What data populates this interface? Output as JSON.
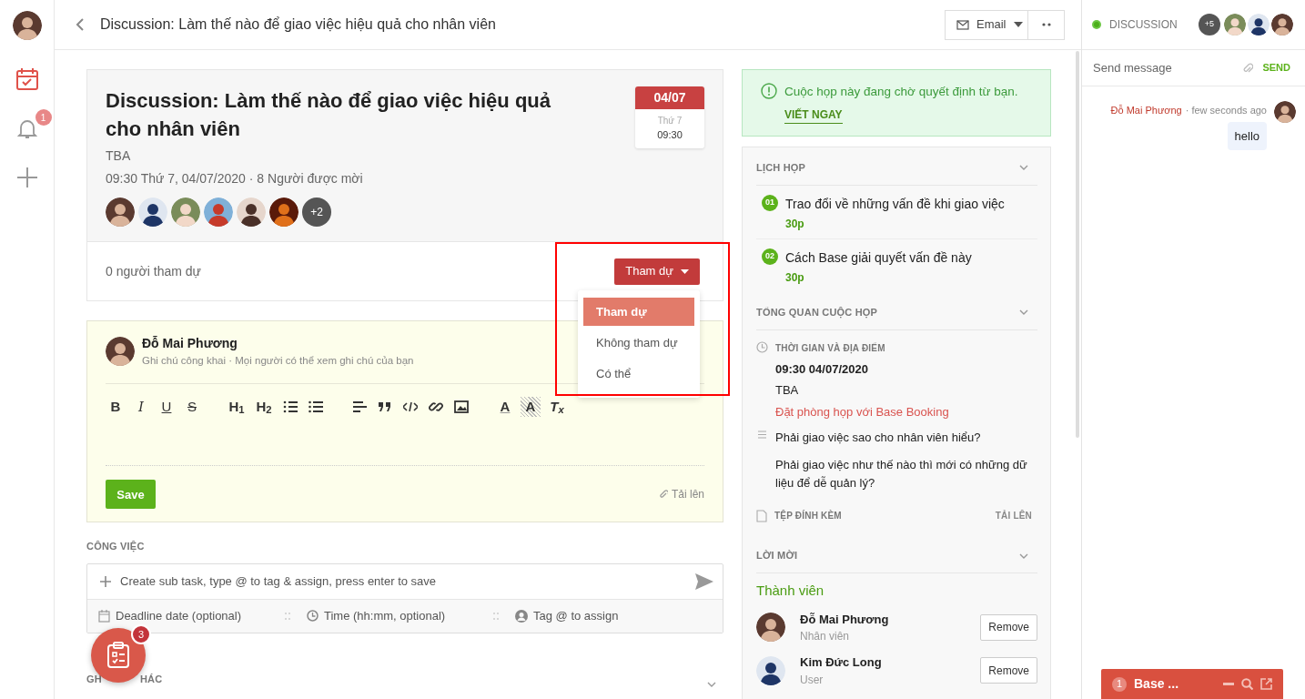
{
  "sidebar": {
    "items": [
      {
        "kind": "calendar",
        "selected": true
      },
      {
        "kind": "bell",
        "selected": false,
        "badge": "1"
      },
      {
        "kind": "add",
        "selected": false
      }
    ]
  },
  "header": {
    "title": "Discussion: Làm thế nào để giao việc hiệu quả cho nhân viên",
    "email_button": "Email"
  },
  "discussion": {
    "label": "DISCUSSION",
    "online": true,
    "more_count": "+5"
  },
  "meeting": {
    "title": "Discussion: Làm thế nào để giao việc hiệu quả cho nhân viên",
    "location": "TBA",
    "schedule": "09:30 Thứ 7, 04/07/2020 · 8 Người được mời",
    "date": {
      "day": "04/07",
      "weekday": "Thứ 7",
      "time": "09:30"
    },
    "more_invitees": "+2"
  },
  "attendance": {
    "count": "0 người tham dự",
    "button": "Tham dự",
    "menu": [
      {
        "label": "Tham dự",
        "selected": true
      },
      {
        "label": "Không tham dự",
        "selected": false
      },
      {
        "label": "Có thể",
        "selected": false
      }
    ]
  },
  "note": {
    "author": "Đỗ Mai Phương",
    "visibility": "Ghi chú công khai · Mọi người có thể xem ghi chú của bạn",
    "toolbar": [
      {
        "kind": "bold",
        "label": "B"
      },
      {
        "kind": "italic",
        "label": "I"
      },
      {
        "kind": "underline",
        "label": "U"
      },
      {
        "kind": "strike",
        "label": "S"
      },
      {
        "kind": "heading",
        "label": "H$_{1}$"
      },
      {
        "kind": "heading",
        "label": "H$_{2}$"
      },
      {
        "kind": "ordered-list"
      },
      {
        "kind": "bullet-list"
      },
      {
        "kind": "align"
      },
      {
        "kind": "quote"
      },
      {
        "kind": "code"
      },
      {
        "kind": "link"
      },
      {
        "kind": "image"
      },
      {
        "kind": "color",
        "label": "A"
      },
      {
        "kind": "highlight",
        "label": "A"
      },
      {
        "kind": "clear",
        "label": "T$_{x}$"
      }
    ],
    "save": "Save",
    "upload": "Tải lên"
  },
  "tasks": {
    "heading": "CÔNG VIỆC",
    "placeholder": "Create sub task, type @ to tag & assign, press enter to save",
    "deadline_placeholder": "Deadline date (optional)",
    "time_placeholder": "Time (hh:mm, optional)",
    "assign_placeholder": "Tag @ to assign"
  },
  "other_notes": {
    "heading_parts": [
      "GH",
      "HÁC"
    ]
  },
  "floating_tasks": {
    "badge": "3"
  },
  "alert": {
    "message": "Cuộc họp này đang chờ quyết định từ bạn.",
    "action": "VIẾT NGAY"
  },
  "agenda": {
    "heading": "LỊCH HỌP",
    "items": [
      {
        "number": "01",
        "title": "Trao đổi về những vấn đề khi giao việc",
        "duration": "30p"
      },
      {
        "number": "02",
        "title": "Cách Base giải quyết vấn đề này",
        "duration": "30p"
      }
    ]
  },
  "overview": {
    "heading": "TỔNG QUAN CUỘC HỌP",
    "time_place_label": "THỜI GIAN VÀ ĐỊA ĐIỂM",
    "datetime": "09:30 04/07/2020",
    "location": "TBA",
    "booking_link": "Đặt phòng họp với Base Booking",
    "description": [
      "Phải giao việc sao cho nhân viên hiểu?",
      "Phải giao việc như thế nào thì mới có những dữ liệu để dễ quản lý?"
    ],
    "attachments_label": "TỆP ĐÍNH KÈM",
    "upload": "TẢI LÊN"
  },
  "invitations": {
    "heading": "LỜI MỜI",
    "group": "Thành viên",
    "members": [
      {
        "name": "Đỗ Mai Phương",
        "role": "Nhân viên",
        "action": "Remove"
      },
      {
        "name": "Kim Đức Long",
        "role": "User",
        "action": "Remove"
      }
    ]
  },
  "chat": {
    "placeholder": "Send message",
    "send": "SEND",
    "messages": [
      {
        "author": "Đỗ Mai Phương",
        "time": "· few seconds ago",
        "text": "hello"
      }
    ]
  },
  "chat_tab": {
    "unread": "1",
    "title": "Base ..."
  }
}
